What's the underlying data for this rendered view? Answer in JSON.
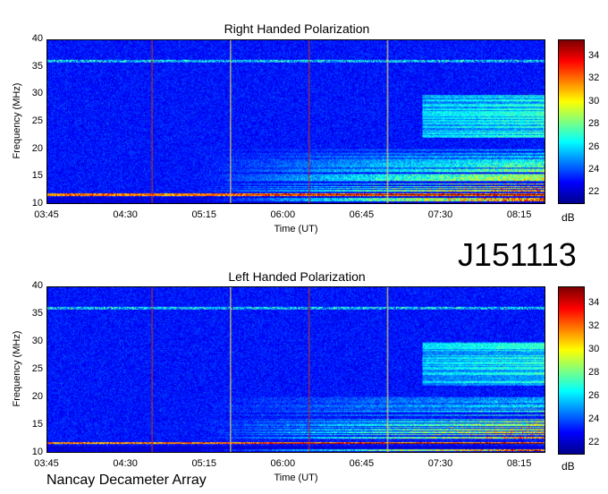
{
  "page": {
    "observation_id": "J151113",
    "instrument": "Nancay Decameter Array"
  },
  "colors": {
    "colormap": [
      "#00008f",
      "#0000ff",
      "#0080ff",
      "#00ffff",
      "#80ff80",
      "#ffff00",
      "#ff8000",
      "#ff0000",
      "#800000"
    ]
  },
  "chart_data": [
    {
      "type": "heatmap",
      "title": "Right Handed Polarization",
      "xlabel": "Time (UT)",
      "ylabel": "Frequency (MHz)",
      "x_ticks": [
        "03:45",
        "04:30",
        "05:15",
        "06:00",
        "06:45",
        "07:30",
        "08:15"
      ],
      "y_ticks": [
        "10",
        "15",
        "20",
        "25",
        "30",
        "35",
        "40"
      ],
      "x_range": [
        "03:45",
        "08:30"
      ],
      "ylim": [
        10,
        40
      ],
      "colorbar": {
        "label": "dB",
        "ticks": [
          "22",
          "24",
          "26",
          "28",
          "30",
          "32",
          "34"
        ],
        "range": [
          21,
          35.5
        ]
      },
      "vertical_lines": [
        "04:45",
        "05:30",
        "06:15",
        "07:00"
      ]
    },
    {
      "type": "heatmap",
      "title": "Left Handed Polarization",
      "xlabel": "Time (UT)",
      "ylabel": "Frequency (MHz)",
      "x_ticks": [
        "03:45",
        "04:30",
        "05:15",
        "06:00",
        "06:45",
        "07:30",
        "08:15"
      ],
      "y_ticks": [
        "10",
        "15",
        "20",
        "25",
        "30",
        "35",
        "40"
      ],
      "x_range": [
        "03:45",
        "08:30"
      ],
      "ylim": [
        10,
        40
      ],
      "colorbar": {
        "label": "dB",
        "ticks": [
          "22",
          "24",
          "26",
          "28",
          "30",
          "32",
          "34"
        ],
        "range": [
          21,
          35.5
        ]
      },
      "vertical_lines": [
        "04:45",
        "05:30",
        "06:15",
        "07:00"
      ]
    }
  ]
}
